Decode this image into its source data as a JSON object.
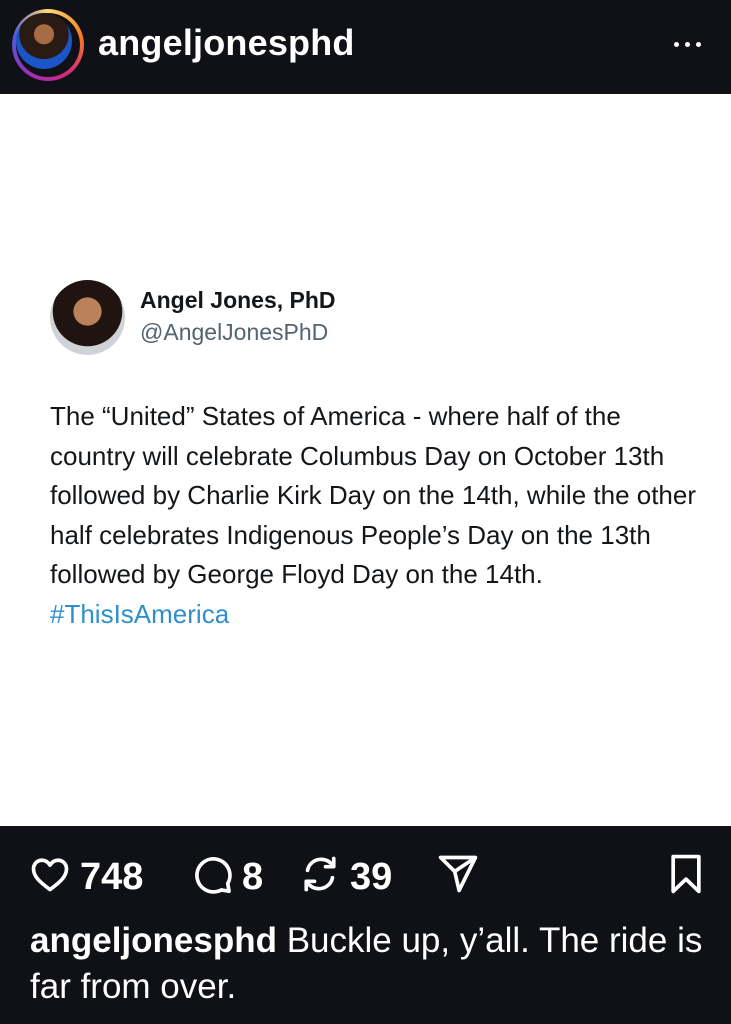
{
  "header": {
    "username": "angeljonesphd",
    "avatar_icon": "profile-avatar",
    "more_icon": "more-horizontal-icon"
  },
  "tweet": {
    "display_name": "Angel Jones, PhD",
    "handle": "@AngelJonesPhD",
    "body": "The “United” States of America - where half of the country will celebrate Columbus Day on October 13th followed by Charlie Kirk Day on the 14th, while the other half celebrates Indigenous People’s Day on the 13th followed by George Floyd Day on the 14th. ",
    "hashtag": "#ThisIsAmerica",
    "hashtag_color": "#2f8fcb"
  },
  "actions": {
    "likes": "748",
    "comments": "8",
    "reposts": "39",
    "icons": [
      "heart-icon",
      "comment-icon",
      "repost-icon",
      "share-icon",
      "bookmark-icon"
    ]
  },
  "caption": {
    "username": "angeljonesphd",
    "text": " Buckle up, y’all. The ride is far from over."
  }
}
